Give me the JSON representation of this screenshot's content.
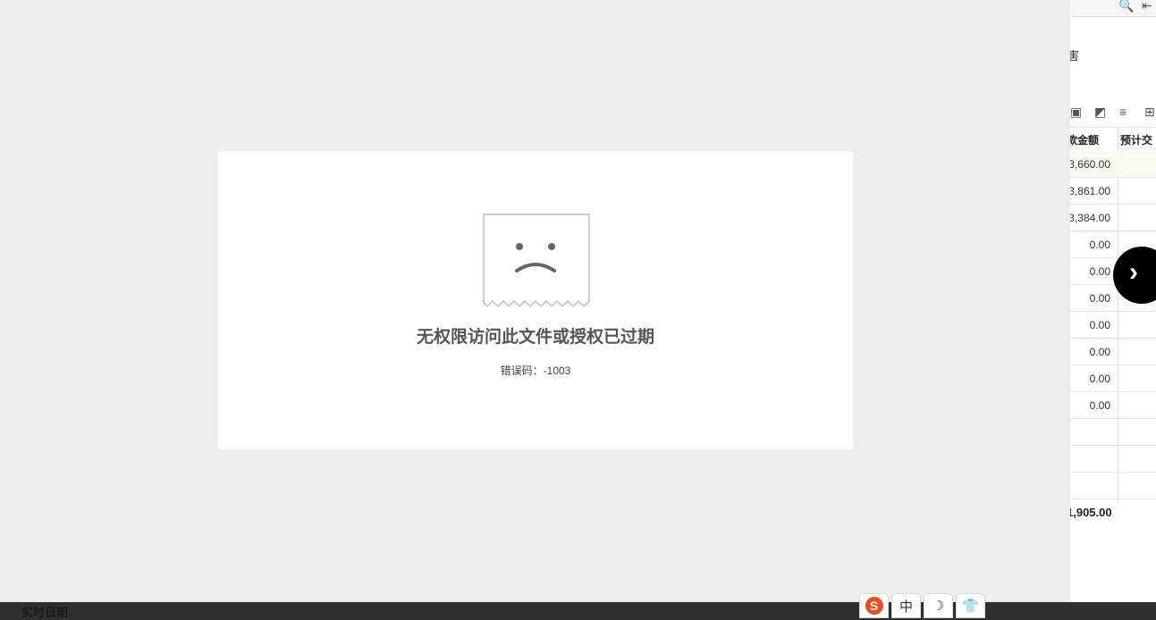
{
  "error_dialog": {
    "title": "无权限访问此文件或授权已过期",
    "code_label": "错误码：",
    "code_value": "-1003"
  },
  "background_app": {
    "title_fragment": "害",
    "columns": [
      "款金额",
      "预计交"
    ],
    "rows": [
      "3,660.00",
      "3,861.00",
      "3,384.00",
      "0.00",
      "0.00",
      "0.00",
      "0.00",
      "0.00",
      "0.00",
      "0.00",
      "",
      "",
      ""
    ],
    "total": "1,905.00"
  },
  "navigation": {
    "next_label": "›"
  },
  "bottom_bar": {
    "text": "实时日期"
  },
  "ime_toolbar": {
    "logo": "S",
    "mode": "中",
    "night": "☽",
    "skin": "👕"
  }
}
